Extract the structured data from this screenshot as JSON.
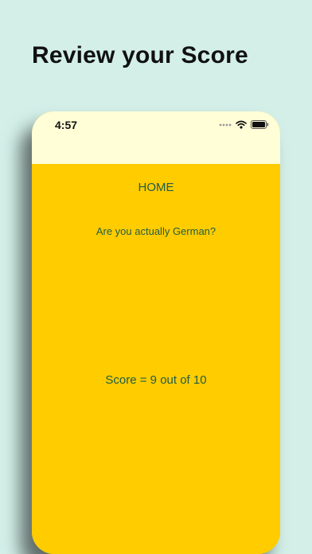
{
  "headline": "Review your Score",
  "status_bar": {
    "time": "4:57",
    "icons": [
      "signal-dots-icon",
      "wifi-icon",
      "battery-icon"
    ]
  },
  "app": {
    "home_label": "HOME",
    "question": "Are you actually German?",
    "score_text": "Score = 9 out of 10"
  },
  "colors": {
    "page_background": "#d3efe8",
    "status_background": "#fffed6",
    "app_background": "#ffcc00",
    "text_accent": "#1f5c48"
  }
}
